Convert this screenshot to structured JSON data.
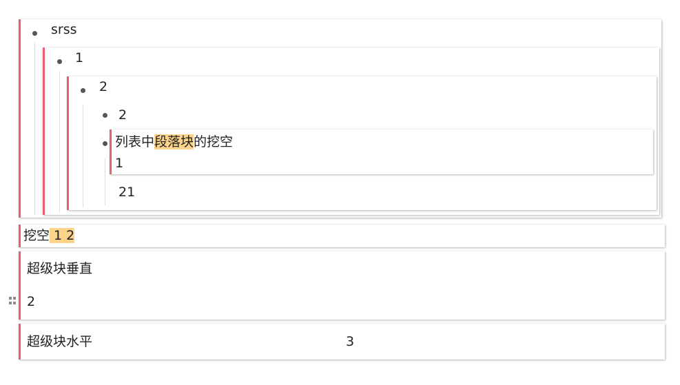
{
  "list": {
    "item_srss": "srss",
    "item_1": "1",
    "item_2_outer": "2",
    "item_2_inner": "2",
    "paragraph": {
      "prefix": "列表中",
      "highlight": "段落块",
      "suffix": "的挖空",
      "line2": "1"
    },
    "item_21": "21"
  },
  "cloze_block": {
    "prefix": "挖空",
    "highlight": " 1 2"
  },
  "super_vertical": {
    "line1": "超级块垂直",
    "line2": "2"
  },
  "super_horizontal": {
    "left": "超级块水平",
    "right": "3"
  },
  "colors": {
    "accent_border": "#e8616a",
    "highlight": "#fbd38a",
    "bullet": "#555555"
  },
  "icons": {
    "drag_handle": "drag-handle-icon",
    "bullet": "bullet-icon"
  }
}
